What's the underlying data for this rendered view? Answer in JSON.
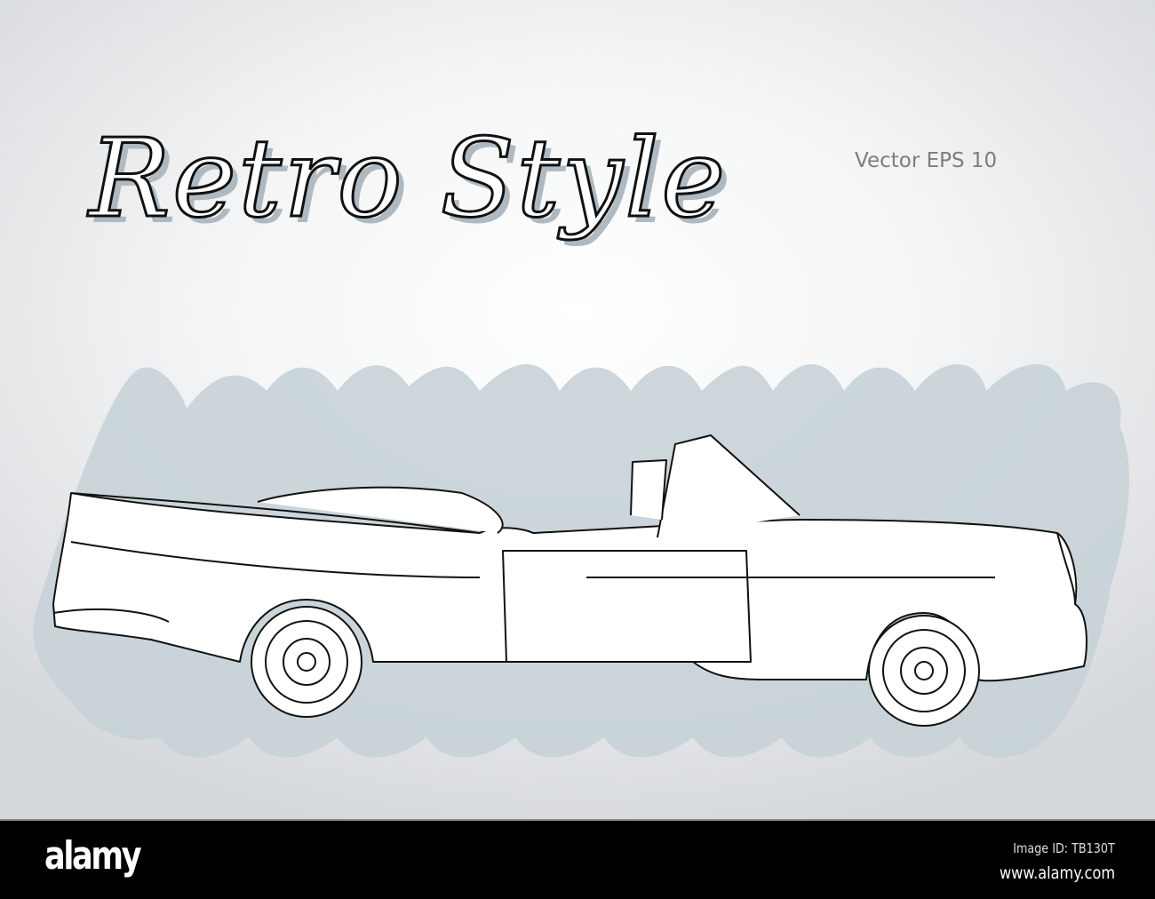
{
  "artwork": {
    "title": "Retro Style",
    "subtitle": "Vector EPS 10",
    "scribble_color": "#c7d1d7",
    "line_color": "#111111"
  },
  "footer": {
    "logo": "alamy",
    "image_id": "Image ID: TB130T",
    "url": "www.alamy.com"
  }
}
